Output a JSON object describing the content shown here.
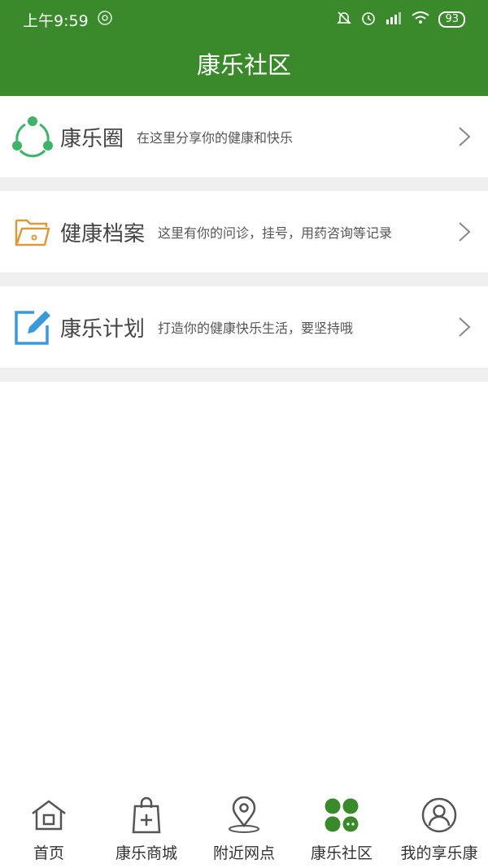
{
  "status": {
    "time": "上午9:59",
    "battery": "93"
  },
  "header": {
    "title": "康乐社区"
  },
  "items": [
    {
      "title": "康乐圈",
      "desc": "在这里分享你的健康和快乐",
      "icon": "share-circle-icon"
    },
    {
      "title": "健康档案",
      "desc": "这里有你的问诊，挂号，用药咨询等记录",
      "icon": "folder-icon"
    },
    {
      "title": "康乐计划",
      "desc": "打造你的健康快乐生活，要坚持哦",
      "icon": "edit-icon"
    }
  ],
  "tabs": [
    {
      "label": "首页",
      "icon": "home-icon"
    },
    {
      "label": "康乐商城",
      "icon": "shopping-bag-icon"
    },
    {
      "label": "附近网点",
      "icon": "location-pin-icon"
    },
    {
      "label": "康乐社区",
      "icon": "community-icon",
      "active": true
    },
    {
      "label": "我的享乐康",
      "icon": "user-icon"
    }
  ],
  "colors": {
    "brand_green": "#3a8a2c",
    "icon_green": "#3fb36a",
    "folder_orange": "#d99a3c",
    "edit_blue": "#3a9ad9"
  }
}
